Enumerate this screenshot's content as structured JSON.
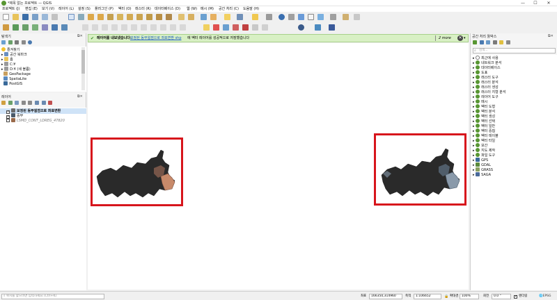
{
  "window": {
    "title": "*제목 없는 프로젝트 — QGIS",
    "minimize": "—",
    "maximize": "☐",
    "close": "✕"
  },
  "menubar": [
    "프로젝트 (J)",
    "편집 (E)",
    "보기 (V)",
    "레이어 (L)",
    "설정 (S)",
    "플러그인 (P)",
    "벡터 (O)",
    "래스터 (R)",
    "데이터베이스 (D)",
    "웹 (W)",
    "메시 (M)",
    "공간 처리 (C)",
    "도움말 (H)"
  ],
  "browser_panel": {
    "title": "탐색기",
    "items": [
      {
        "label": "즐겨찾기",
        "icon": "star-icon"
      },
      {
        "label": "공간 북마크",
        "icon": "bookmark-icon"
      },
      {
        "label": "홈",
        "icon": "folder-icon"
      },
      {
        "label": "C:¥",
        "icon": "drive-icon"
      },
      {
        "label": "D:¥ (새 볼륨)",
        "icon": "drive-icon"
      },
      {
        "label": "GeoPackage",
        "icon": "geopackage-icon"
      },
      {
        "label": "SpatiaLite",
        "icon": "spatialite-icon"
      },
      {
        "label": "PostGIS",
        "icon": "postgis-icon"
      }
    ]
  },
  "layers_panel": {
    "title": "레이어",
    "layers": [
      {
        "label": "보정된 동부웜점으로 좌표변환",
        "checked": true,
        "swatch": "#6a6a6a",
        "italic": false,
        "selected": true
      },
      {
        "label": "중부",
        "checked": true,
        "swatch": "#4a5a6a",
        "italic": false,
        "selected": false
      },
      {
        "label": "LSMD_CONT_LDREG_47820",
        "checked": false,
        "swatch": "#9a6a4a",
        "italic": true,
        "selected": false
      }
    ]
  },
  "message_bar": {
    "title": "레이어를 내보냈습니다:",
    "link": "보정된 동부웜점으로 좌표변환 shp",
    "text": "에 벡터 레이어를 성공적으로 저장했습니다",
    "more": "2 more"
  },
  "toolbox": {
    "title": "공간 처리 툴박스",
    "search_placeholder": "검색...",
    "items": [
      "최근에 사용",
      "네트워크 분석",
      "데이터베이스",
      "도표",
      "래스터 도구",
      "래스터 분석",
      "래스터 생성",
      "래스터 지형 분석",
      "레이어 도구",
      "메시",
      "벡터 도형",
      "벡터 분석",
      "벡터 생성",
      "벡터 선택",
      "벡터 일반",
      "벡터 중첩",
      "벡터 테이블",
      "벡터 타일",
      "보간",
      "지도 제작",
      "파일 도구",
      "GPS",
      "GDAL",
      "GRASS",
      "SAGA"
    ]
  },
  "statusbar": {
    "locator_placeholder": "위치를 찾으려면 입력하세요 (Ctrl+K)",
    "coord_label": "좌표",
    "coord_value": "166350,314960",
    "scale_label": "축척",
    "scale_value": "1:106652",
    "magnifier_label": "확대경",
    "magnifier_value": "100%",
    "rotation_label": "회전",
    "rotation_value": "0.0 °",
    "render_label": "렌더링",
    "crs_label": "EPSG"
  },
  "colors": {
    "qgis_green": "#589632",
    "highlight_red": "#d7151c",
    "message_bg": "#d8f0c4"
  }
}
